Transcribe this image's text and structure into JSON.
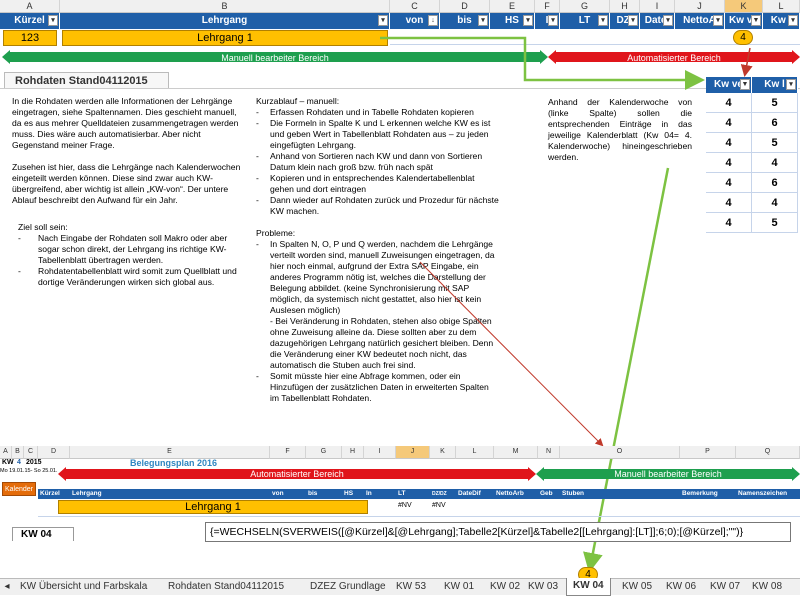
{
  "top_columns": [
    "A",
    "B",
    "C",
    "D",
    "E",
    "F",
    "G",
    "H",
    "I",
    "J",
    "K",
    "L"
  ],
  "top_headers": [
    "Kürzel",
    "Lehrgang",
    "von",
    "bis",
    "HS",
    "I",
    "LT",
    "DZ/",
    "Datei",
    "NettoA",
    "Kw ve",
    "Kw l"
  ],
  "row1": {
    "kuerzel": "123",
    "lehrgang": "Lehrgang 1"
  },
  "marker_top": "4",
  "bar_manual_top": "Manuell bearbeiter Bereich",
  "bar_auto_top": "Automatisierter Bereich",
  "sheet_tab_top": "Rohdaten Stand04112015",
  "kw_table": {
    "headers": [
      "Kw ve",
      "Kw l"
    ],
    "rows": [
      [
        "4",
        "5"
      ],
      [
        "4",
        "6"
      ],
      [
        "4",
        "5"
      ],
      [
        "4",
        "4"
      ],
      [
        "4",
        "6"
      ],
      [
        "4",
        "4"
      ],
      [
        "4",
        "5"
      ]
    ]
  },
  "text_left": {
    "p1": "In die Rohdaten werden alle  Informationen der Lehrgänge eingetragen, siehe Spaltennamen. Dies geschieht manuell, da es aus mehrer Quelldateien zusammengetragen werden muss. Dies wäre auch automatisierbar. Aber nicht Gegenstand meiner Frage.",
    "p2": "Zusehen ist hier, dass die Lehrgänge nach Kalenderwochen eingeteilt  werden können. Diese sind zwar auch KW-übergreifend, aber wichtig ist allein „KW-von“. Der untere Ablauf beschreibt den Aufwand für ein Jahr.",
    "goal_title": "Ziel soll sein:",
    "goal_items": [
      "Nach Eingabe der Rohdaten soll Makro  oder aber sogar schon direkt, der Lehrgang ins richtige KW-Tabellenblatt übertragen werden.",
      "Rohdatentabellenblatt  wird somit zum Quellblatt und dortige Veränderungen wirken sich global aus."
    ]
  },
  "text_mid": {
    "title": "Kurzablauf – manuell:",
    "items": [
      "Erfassen Rohdaten und in Tabelle Rohdaten kopieren",
      "Die Formeln in Spalte K und L erkennen welche KW es ist und geben Wert in Tabellenblatt Rohdaten aus – zu jeden eingefügten Lehrgang.",
      "Anhand von Sortieren nach KW und dann von Sortieren Datum klein nach groß bzw. früh nach spät",
      "Kopieren und in entsprechendes Kalendertabellenblat gehen und dort eintragen",
      "Dann wieder auf Rohdaten zurück und Prozedur für nächste KW machen."
    ],
    "problems_title": "Probleme:",
    "problems": [
      "In Spalten N, O, P und Q werden, nachdem die Lehrgänge verteilt worden sind, manuell Zuweisungen eingetragen, da hier  noch einmal, aufgrund der Extra SAP Eingabe,  ein anderes Programm nötig ist, welches die Darstellung der Belegung abbildet. (keine Synchronisierung mit SAP möglich, da systemisch nicht gestattet, also hier ist kein Auslesen möglich)\n- Bei Veränderung in Rohdaten, stehen also obige Spalten ohne Zuweisung alleine da. Diese sollten aber zu dem dazugehörigen Lehrgang natürlich gesichert bleiben. Denn die Veränderung einer KW bedeutet noch nicht, das automatisch die Stuben auch frei sind.",
      "Somit müsste hier eine Abfrage kommen, oder ein Hinzufügen der zusätzlichen Daten in erweiterten Spalten im Tabellenblatt Rohdaten."
    ]
  },
  "text_right": "Anhand der Kalenderwoche von (linke Spalte) sollen die entsprechenden Einträge in das jeweilige Kalenderblatt (Kw 04= 4. Kalenderwoche) hineingeschrieben werden.",
  "bottom": {
    "columns": [
      "A",
      "B",
      "C",
      "D",
      "E",
      "F",
      "G",
      "H",
      "I",
      "J",
      "K",
      "L",
      "M",
      "N",
      "O",
      "P",
      "Q"
    ],
    "kw_label": "KW",
    "kw_value": "4",
    "year": "2015",
    "plan_title": "Belegungsplan 2016",
    "date_range": "Mo 19.01.15- So 25.01.",
    "bar_auto": "Automatisierter Bereich",
    "bar_manual": "Manuell bearbeiter Bereich",
    "kalender_btn": "Kalender",
    "headers": [
      "Kürzel",
      "Lehrgang",
      "von",
      "bis",
      "HS",
      "In",
      "LT",
      "DZ/DZ",
      "DateDif",
      "NettoArb",
      "Geb",
      "Stuben",
      "Bemerkung",
      "Namenszeichen"
    ],
    "lehrgang": "Lehrgang 1",
    "nv1": "#NV",
    "nv2": "#NV",
    "sheet_tab": "KW 04",
    "formula": "{=WECHSELN(SVERWEIS([@Kürzel]&[@Lehrgang];Tabelle2[Kürzel]&Tabelle2[[Lehrgang]:[LT]];6;0);[@Kürzel];\"\")}"
  },
  "marker_bottom": "4",
  "sheet_tabs": [
    "KW Übersicht und Farbskala",
    "Rohdaten Stand04112015",
    "DZEZ Grundlage",
    "KW 53",
    "KW 01",
    "KW 02",
    "KW 03",
    "KW 04",
    "KW 05",
    "KW 06",
    "KW 07",
    "KW 08"
  ],
  "active_tab": "KW 04",
  "colors": {
    "header_blue": "#1f5fa8",
    "yellow": "#ffc000",
    "green": "#1e9f4e",
    "red": "#e0151b"
  }
}
